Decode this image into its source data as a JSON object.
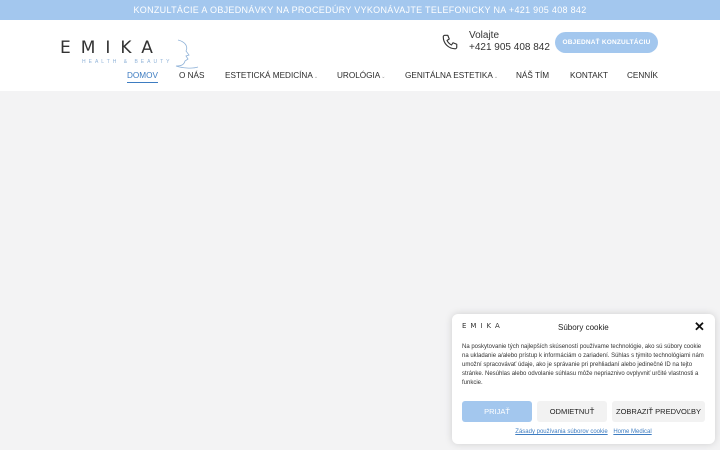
{
  "topbar": {
    "text": "KONZULTÁCIE A OBJEDNÁVKY NA PROCEDÚRY VYKONÁVAJTE TELEFONICKY NA +421 905 408 842"
  },
  "brand": {
    "logo": "EMIKA",
    "tagline": "HEALTH & BEAUTY",
    "accent": "#a3c7ee"
  },
  "header": {
    "call_label": "Volajte",
    "call_number": "+421 905 408 842",
    "cta_label": "OBJEDNAŤ KONZULTÁCIU"
  },
  "nav": {
    "items": [
      {
        "label": "DOMOV",
        "active": true
      },
      {
        "label": "O NÁS"
      },
      {
        "label": "ESTETICKÁ MEDICÍNA",
        "dropdown": true
      },
      {
        "label": "UROLÓGIA",
        "dropdown": true
      },
      {
        "label": "GENITÁLNA ESTETIKA",
        "dropdown": true
      },
      {
        "label": "NÁŠ TÍM"
      },
      {
        "label": "KONTAKT"
      },
      {
        "label": "CENNÍK"
      }
    ]
  },
  "cookie": {
    "logo": "EMIKA",
    "title": "Súbory cookie",
    "text": "Na poskytovanie tých najlepších skúseností používame technológie, ako sú súbory cookie na ukladanie a/alebo prístup k informáciám o zariadení. Súhlas s týmito technológiami nám umožní spracovávať údaje, ako je správanie pri prehliadaní alebo jedinečné ID na tejto stránke. Nesúhlas alebo odvolanie súhlasu môže nepriaznivo ovplyvniť určité vlastnosti a funkcie.",
    "accept": "PRIJAŤ",
    "deny": "ODMIETNUŤ",
    "prefs": "ZOBRAZIŤ PREDVOĽBY",
    "link_policy": "Zásady používania súborov cookie",
    "link_home": "Home Medical"
  }
}
